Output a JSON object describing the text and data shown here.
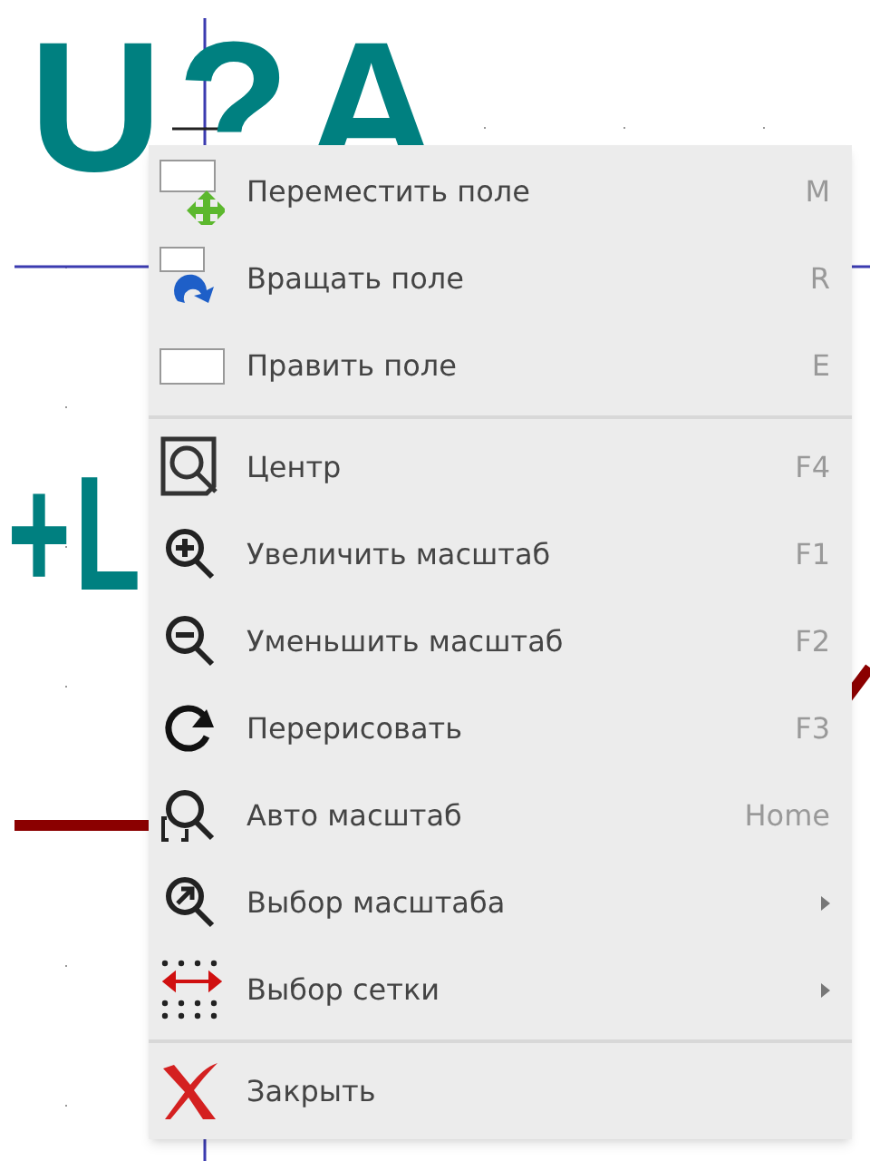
{
  "canvas": {
    "labels": [
      {
        "text": "U?A"
      },
      {
        "text": "+L"
      }
    ]
  },
  "menu": {
    "items": [
      {
        "kind": "item",
        "label": "Переместить поле",
        "shortcut": "M",
        "submenu": false
      },
      {
        "kind": "item",
        "label": "Вращать поле",
        "shortcut": "R",
        "submenu": false
      },
      {
        "kind": "item",
        "label": "Править поле",
        "shortcut": "E",
        "submenu": false
      },
      {
        "kind": "separator"
      },
      {
        "kind": "item",
        "label": "Центр",
        "shortcut": "F4",
        "submenu": false
      },
      {
        "kind": "item",
        "label": "Увеличить масштаб",
        "shortcut": "F1",
        "submenu": false
      },
      {
        "kind": "item",
        "label": "Уменьшить масштаб",
        "shortcut": "F2",
        "submenu": false
      },
      {
        "kind": "item",
        "label": "Перерисовать",
        "shortcut": "F3",
        "submenu": false
      },
      {
        "kind": "item",
        "label": "Авто масштаб",
        "shortcut": "Home",
        "submenu": false
      },
      {
        "kind": "item",
        "label": "Выбор масштаба",
        "submenu": true
      },
      {
        "kind": "item",
        "label": "Выбор сетки",
        "submenu": true
      },
      {
        "kind": "separator"
      },
      {
        "kind": "item",
        "label": "Закрыть",
        "submenu": false
      }
    ]
  }
}
